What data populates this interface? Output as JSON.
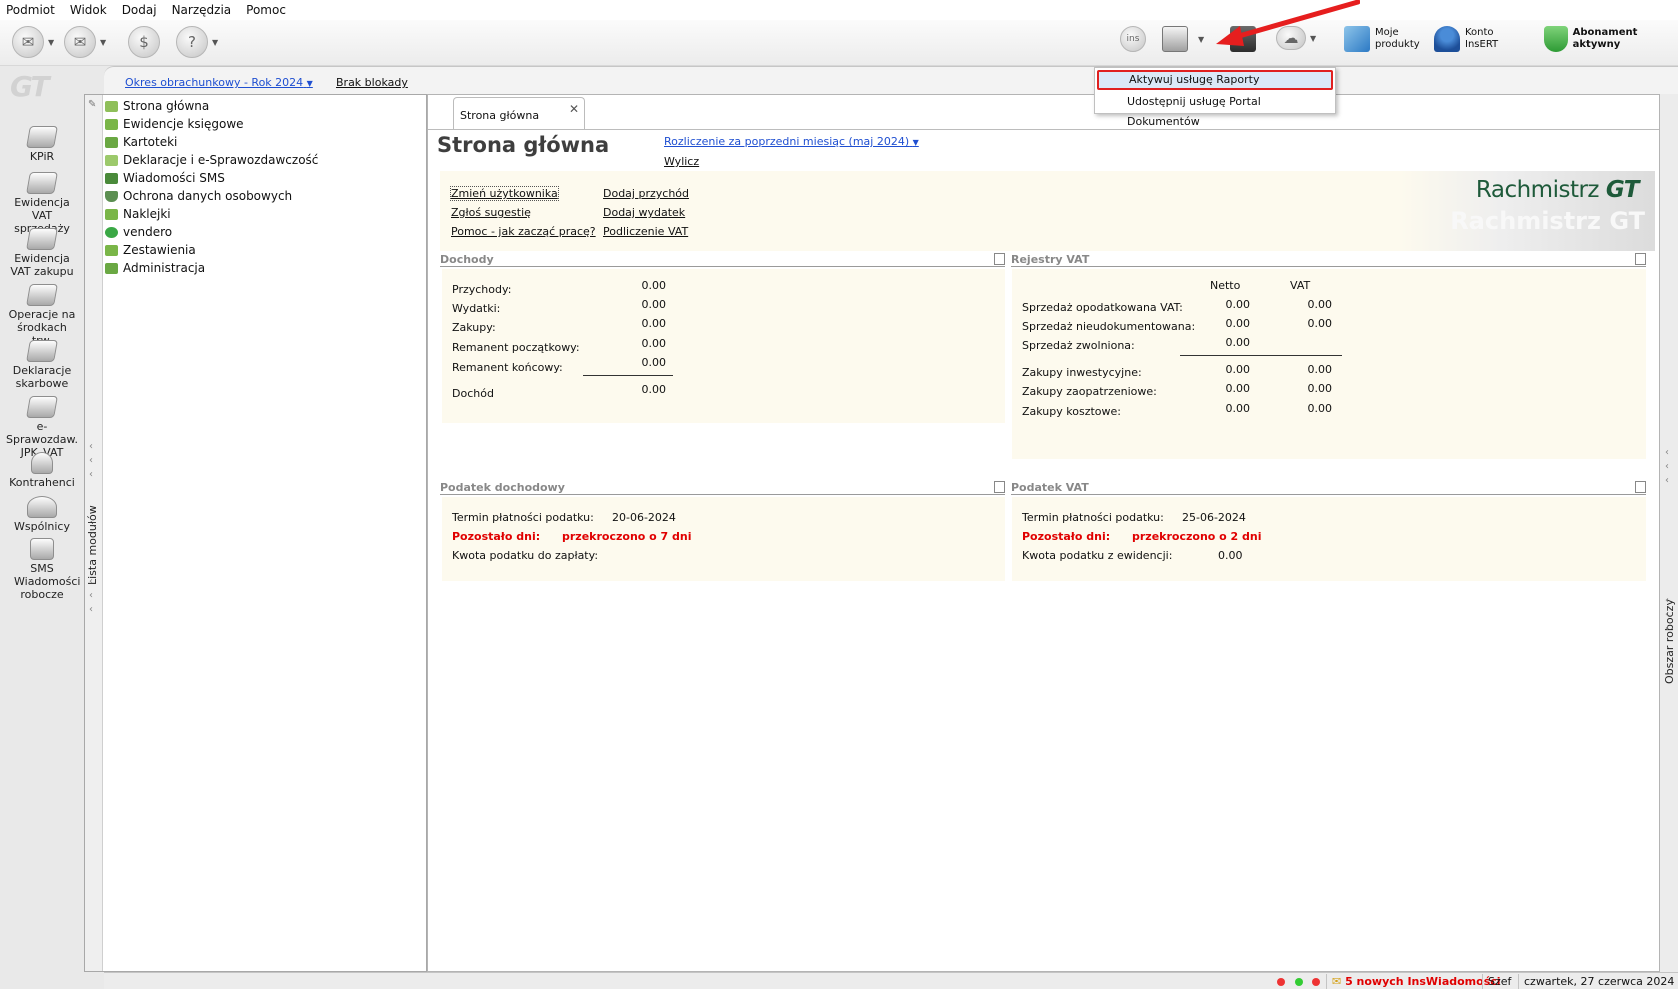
{
  "menu": [
    "Podmiot",
    "Widok",
    "Dodaj",
    "Narzędzia",
    "Pomoc"
  ],
  "toolbar": {
    "ins_icon_text": "ins",
    "moje_produkty": [
      "Moje",
      "produkty"
    ],
    "konto_insert": [
      "Konto",
      "InsERT"
    ],
    "abonament": "Abonament aktywny"
  },
  "dropdown": {
    "items": [
      "Aktywuj usługę Raporty",
      "Udostępnij usługę Portal Dokumentów"
    ]
  },
  "sidebar": {
    "logo": "GT",
    "modules": [
      {
        "label": "KPiR"
      },
      {
        "label": "Ewidencja VAT sprzedaży"
      },
      {
        "label": "Ewidencja VAT zakupu"
      },
      {
        "label": "Operacje na środkach trw."
      },
      {
        "label": "Deklaracje skarbowe"
      },
      {
        "label": "e-Sprawozdaw. JPK_VAT"
      },
      {
        "label": "Kontrahenci"
      },
      {
        "label": "Wspólnicy"
      },
      {
        "label": "SMS Wiadomości robocze"
      }
    ]
  },
  "period": {
    "link": "Okres obrachunkowy - Rok 2024",
    "blokada": "Brak blokady"
  },
  "module_list": {
    "title": "Lista modułów",
    "items": [
      {
        "label": "Strona główna",
        "color": "#8fbf5a"
      },
      {
        "label": "Ewidencje księgowe",
        "color": "#7ab648"
      },
      {
        "label": "Kartoteki",
        "color": "#6aa843"
      },
      {
        "label": "Deklaracje i e-Sprawozdawczość",
        "color": "#9cc96b"
      },
      {
        "label": "Wiadomości SMS",
        "color": "#4a8a3a"
      },
      {
        "label": "Ochrona danych osobowych",
        "color": "#5c8f52"
      },
      {
        "label": "Naklejki",
        "color": "#7ab648"
      },
      {
        "label": "vendero",
        "color": "#3aa845"
      },
      {
        "label": "Zestawienia",
        "color": "#7ab648"
      },
      {
        "label": "Administracja",
        "color": "#6aa843"
      }
    ]
  },
  "main": {
    "tab": "Strona główna",
    "title": "Strona główna",
    "rozliczenie": "Rozliczenie za poprzedni miesiąc (maj 2024)",
    "wylicz": "Wylicz",
    "quick_links": [
      "Zmień użytkownika",
      "Zgłoś sugestię",
      "Pomoc - jak zacząć pracę?",
      "Dodaj przychód",
      "Dodaj wydatek",
      "Podliczenie VAT"
    ],
    "brand": {
      "name": "Rachmistrz",
      "suffix": "GT",
      "ghost": "Rachmistrz GT"
    },
    "dochody": {
      "title": "Dochody",
      "rows": [
        {
          "label": "Przychody:",
          "value": "0.00"
        },
        {
          "label": "Wydatki:",
          "value": "0.00"
        },
        {
          "label": "Zakupy:",
          "value": "0.00"
        },
        {
          "label": "Remanent początkowy:",
          "value": "0.00"
        },
        {
          "label": "Remanent końcowy:",
          "value": "0.00"
        }
      ],
      "total_label": "Dochód",
      "total_value": "0.00"
    },
    "rejestry": {
      "title": "Rejestry VAT",
      "col_netto": "Netto",
      "col_vat": "VAT",
      "rows": [
        {
          "label": "Sprzedaż opodatkowana VAT:",
          "netto": "0.00",
          "vat": "0.00"
        },
        {
          "label": "Sprzedaż nieudokumentowana:",
          "netto": "0.00",
          "vat": "0.00"
        },
        {
          "label": "Sprzedaż zwolniona:",
          "netto": "0.00",
          "vat": ""
        },
        {
          "label": "Zakupy inwestycyjne:",
          "netto": "0.00",
          "vat": "0.00"
        },
        {
          "label": "Zakupy zaopatrzeniowe:",
          "netto": "0.00",
          "vat": "0.00"
        },
        {
          "label": "Zakupy kosztowe:",
          "netto": "0.00",
          "vat": "0.00"
        }
      ]
    },
    "podatek_dochodowy": {
      "title": "Podatek dochodowy",
      "termin_label": "Termin płatności podatku:",
      "termin_value": "20-06-2024",
      "pozostalo_label": "Pozostało dni:",
      "pozostalo_value": "przekroczono o 7 dni",
      "kwota_label": "Kwota podatku do zapłaty:"
    },
    "podatek_vat": {
      "title": "Podatek VAT",
      "termin_label": "Termin płatności podatku:",
      "termin_value": "25-06-2024",
      "pozostalo_label": "Pozostało dni:",
      "pozostalo_value": "przekroczono o 2 dni",
      "kwota_label": "Kwota podatku z ewidencji:",
      "kwota_value": "0.00"
    }
  },
  "right_strip": {
    "label": "Obszar roboczy"
  },
  "status": {
    "messages": "5 nowych InsWiadomości",
    "user": "Szef",
    "date": "czwartek, 27 czerwca 2024"
  },
  "colors": {
    "accent_link": "#1f4fd1",
    "alert": "#e00000",
    "panel_bg": "#fdfaee",
    "brand_green": "#1e5a3a"
  }
}
